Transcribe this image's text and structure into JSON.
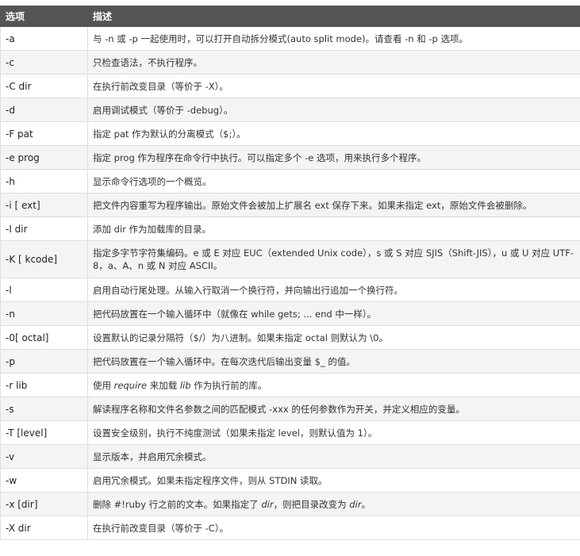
{
  "header": {
    "option": "选项",
    "description": "描述"
  },
  "rows": [
    {
      "option": "-a",
      "desc": [
        "与 -n 或 -p 一起使用时，可以打开自动拆分模式(auto split mode)。请查看 -n 和 -p 选项。"
      ]
    },
    {
      "option": "-c",
      "desc": [
        "只检查语法，不执行程序。"
      ]
    },
    {
      "option": "-C dir",
      "desc": [
        "在执行前改变目录（等价于 -X）。"
      ]
    },
    {
      "option": "-d",
      "desc": [
        "启用调试模式（等价于 -debug）。"
      ]
    },
    {
      "option": "-F pat",
      "desc": [
        "指定 pat 作为默认的分离模式（$;）。"
      ]
    },
    {
      "option": "-e prog",
      "desc": [
        "指定 prog 作为程序在命令行中执行。可以指定多个 -e 选项，用来执行多个程序。"
      ]
    },
    {
      "option": "-h",
      "desc": [
        "显示命令行选项的一个概览。"
      ]
    },
    {
      "option": "-i [ ext]",
      "desc": [
        "把文件内容重写为程序输出。原始文件会被加上扩展名 ext 保存下来。如果未指定 ext，原始文件会被删除。"
      ]
    },
    {
      "option": "-I dir",
      "desc": [
        "添加 dir 作为加载库的目录。"
      ]
    },
    {
      "option": "-K [ kcode]",
      "desc": [
        "指定多字节字符集编码。e 或 E 对应 EUC（extended Unix code），s 或 S 对应 SJIS（Shift-JIS），u 或 U 对应 UTF-8，a、A、n 或 N 对应 ASCII。"
      ]
    },
    {
      "option": "-l",
      "desc": [
        "启用自动行尾处理。从输入行取消一个换行符，并向输出行追加一个换行符。"
      ]
    },
    {
      "option": "-n",
      "desc": [
        "把代码放置在一个输入循环中（就像在 while gets; ... end 中一样）。"
      ]
    },
    {
      "option": "-0[ octal]",
      "desc": [
        "设置默认的记录分隔符（$/）为八进制。如果未指定 octal 则默认为 \\0。"
      ]
    },
    {
      "option": "-p",
      "desc": [
        "把代码放置在一个输入循环中。在每次迭代后输出变量 $_ 的值。"
      ]
    },
    {
      "option": "-r lib",
      "desc": [
        "使用 ",
        "require",
        " 来加载 ",
        "lib",
        " 作为执行前的库。"
      ]
    },
    {
      "option": "-s",
      "desc": [
        "解读程序名称和文件名参数之间的匹配模式 -xxx 的任何参数作为开关，并定义相应的变量。"
      ]
    },
    {
      "option": "-T [level]",
      "desc": [
        "设置安全级别，执行不纯度测试（如果未指定 level，则默认值为 1）。"
      ]
    },
    {
      "option": "-v",
      "desc": [
        "显示版本，并启用冗余模式。"
      ]
    },
    {
      "option": "-w",
      "desc": [
        "启用冗余模式。如果未指定程序文件，则从 STDIN 读取。"
      ]
    },
    {
      "option": "-x [dir]",
      "desc": [
        "删除 #!ruby 行之前的文本。如果指定了 ",
        "dir",
        "，则把目录改变为 ",
        "dir",
        "。"
      ]
    },
    {
      "option": "-X dir",
      "desc": [
        "在执行前改变目录（等价于 -C）。"
      ]
    }
  ]
}
